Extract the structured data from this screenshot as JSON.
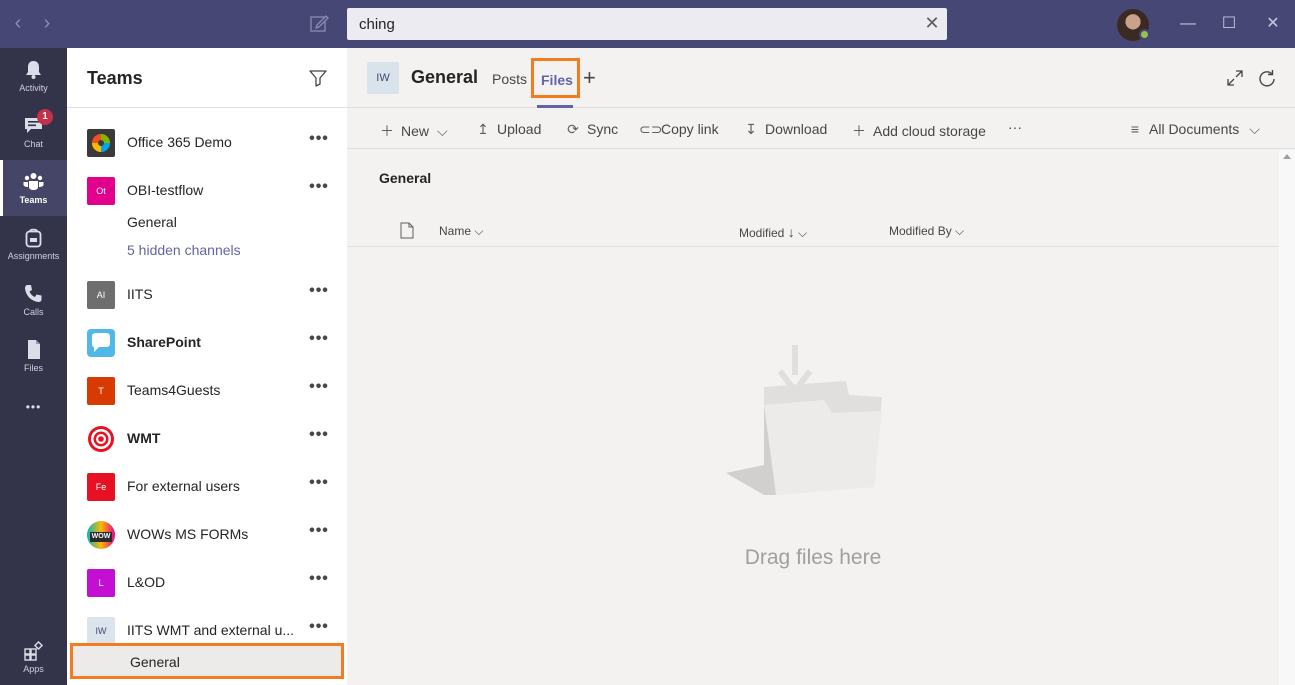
{
  "titlebar": {
    "search_value": "ching",
    "back_icon": "chevron-left-icon",
    "forward_icon": "chevron-right-icon",
    "compose_icon": "compose-icon",
    "clear_glyph": "✕",
    "back_glyph": "‹",
    "forward_glyph": "›",
    "minimize_glyph": "—",
    "maximize_glyph": "☐",
    "close_glyph": "✕"
  },
  "rail": {
    "items": [
      {
        "label": "Activity",
        "icon": "bell-icon"
      },
      {
        "label": "Chat",
        "icon": "chat-icon",
        "badge": "1"
      },
      {
        "label": "Teams",
        "icon": "teams-icon"
      },
      {
        "label": "Assignments",
        "icon": "backpack-icon"
      },
      {
        "label": "Calls",
        "icon": "phone-icon"
      },
      {
        "label": "Files",
        "icon": "file-icon"
      },
      {
        "label": "",
        "icon": "more-icon"
      },
      {
        "label": "Apps",
        "icon": "apps-icon"
      }
    ],
    "more_glyph": "•••"
  },
  "teams_panel": {
    "title": "Teams",
    "teams": [
      {
        "name": "Office 365 Demo",
        "logo_text": "",
        "logo_color": "#3b3a39"
      },
      {
        "name": "OBI-testflow",
        "logo_text": "Ot",
        "logo_color": "#e3008c"
      },
      {
        "name": "IITS",
        "logo_text": "AI",
        "logo_color": "#6e6e6e"
      },
      {
        "name": "SharePoint",
        "logo_text": "",
        "logo_color": "#4fb8e8"
      },
      {
        "name": "Teams4Guests",
        "logo_text": "T",
        "logo_color": "#d83b01"
      },
      {
        "name": "WMT",
        "logo_text": "",
        "logo_color": "#e81123"
      },
      {
        "name": "For external users",
        "logo_text": "Fe",
        "logo_color": "#e81123"
      },
      {
        "name": "WOWs MS FORMs",
        "logo_text": "WOW",
        "logo_color": "#2b2b2b"
      },
      {
        "name": "L&OD",
        "logo_text": "L",
        "logo_color": "#c30fd1"
      },
      {
        "name": "IITS WMT and external u...",
        "logo_text": "IW",
        "logo_color": "#dbe4ed"
      }
    ],
    "channels": {
      "obi_general": "General",
      "obi_hidden": "5 hidden channels",
      "iw_general": "General"
    },
    "more_glyph": "•••"
  },
  "main": {
    "channel_avatar": "IW",
    "channel_title": "General",
    "tabs": {
      "posts": "Posts",
      "files": "Files",
      "add": "+"
    },
    "toolbar": {
      "new": "New",
      "upload": "Upload",
      "sync": "Sync",
      "copy_link": "Copy link",
      "download": "Download",
      "add_cloud": "Add cloud storage",
      "more": "···",
      "view": "All Documents"
    },
    "section_title": "General",
    "columns": {
      "name": "Name",
      "modified": "Modified",
      "modified_by": "Modified By"
    },
    "empty_text": "Drag files here"
  },
  "colors": {
    "titlebar": "#464775",
    "rail": "#33344a",
    "accent": "#6264a7",
    "highlight_box": "#f47c20"
  }
}
